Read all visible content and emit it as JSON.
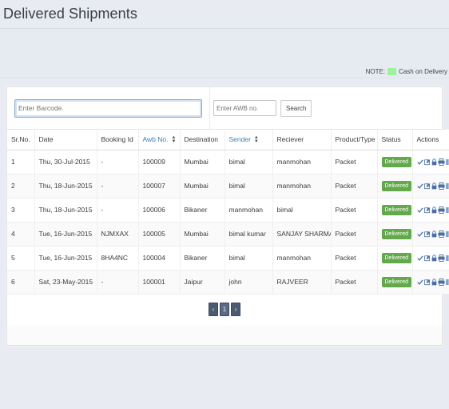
{
  "header": {
    "title": "Delivered Shipments"
  },
  "note": {
    "label": "NOTE:",
    "legend": "Cash on Delivery",
    "swatch_color": "#9ff09f"
  },
  "search": {
    "barcode_placeholder": "Enter Barcode.",
    "barcode_value": "",
    "awb_placeholder": "Enter AWB no.",
    "awb_value": "",
    "search_button": "Search"
  },
  "table": {
    "columns": [
      {
        "label": "Sr.No.",
        "sortable": false
      },
      {
        "label": "Date",
        "sortable": false
      },
      {
        "label": "Booking Id",
        "sortable": false
      },
      {
        "label": "Awb No.",
        "sortable": true
      },
      {
        "label": "Destination",
        "sortable": false
      },
      {
        "label": "Sender",
        "sortable": true
      },
      {
        "label": "Reciever",
        "sortable": false
      },
      {
        "label": "Product/Type",
        "sortable": false
      },
      {
        "label": "Status",
        "sortable": false
      },
      {
        "label": "Actions",
        "sortable": false
      }
    ],
    "rows": [
      {
        "sr": "1",
        "date": "Thu, 30-Jul-2015",
        "booking_id": "-",
        "awb": "100009",
        "destination": "Mumbai",
        "sender": "bimal",
        "receiver": "manmohan",
        "product": "Packet",
        "status": "Delivered"
      },
      {
        "sr": "2",
        "date": "Thu, 18-Jun-2015",
        "booking_id": "-",
        "awb": "100007",
        "destination": "Mumbai",
        "sender": "bimal",
        "receiver": "manmohan",
        "product": "Packet",
        "status": "Delivered"
      },
      {
        "sr": "3",
        "date": "Thu, 18-Jun-2015",
        "booking_id": "-",
        "awb": "100006",
        "destination": "Bikaner",
        "sender": "manmohan",
        "receiver": "bimal",
        "product": "Packet",
        "status": "Delivered"
      },
      {
        "sr": "4",
        "date": "Tue, 16-Jun-2015",
        "booking_id": "NJMXAX",
        "awb": "100005",
        "destination": "Mumbai",
        "sender": "bimal kumar",
        "receiver": "SANJAY SHARMA",
        "product": "Packet",
        "status": "Delivered"
      },
      {
        "sr": "5",
        "date": "Tue, 16-Jun-2015",
        "booking_id": "8HA4NC",
        "awb": "100004",
        "destination": "Bikaner",
        "sender": "bimal",
        "receiver": "manmohan",
        "product": "Packet",
        "status": "Delivered"
      },
      {
        "sr": "6",
        "date": "Sat, 23-May-2015",
        "booking_id": "-",
        "awb": "100001",
        "destination": "Jaipur",
        "sender": "john",
        "receiver": "RAJVEER",
        "product": "Packet",
        "status": "Delivered"
      }
    ],
    "action_icons": [
      "check-icon",
      "edit-icon",
      "lock-icon",
      "print-icon",
      "barcode-icon",
      "refresh-icon"
    ]
  },
  "pagination": {
    "prev_label": "‹",
    "pages": [
      "1"
    ],
    "next_label": "›"
  },
  "colors": {
    "accent_link": "#3f7bbf",
    "status_green": "#63a84b",
    "page_bg": "#e8ecf2",
    "pagination_bg": "#4c5a72"
  }
}
